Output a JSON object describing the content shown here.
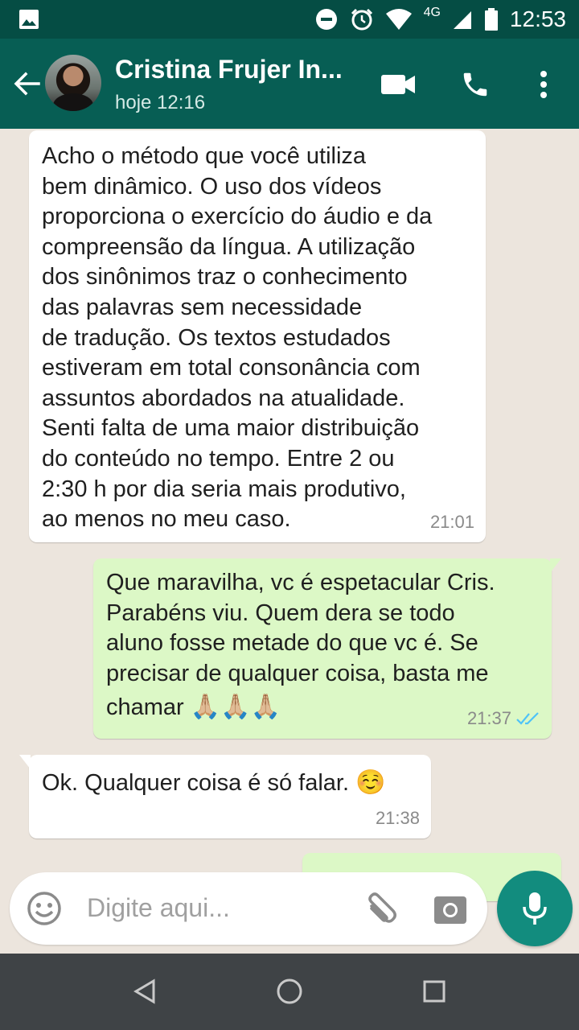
{
  "status_bar": {
    "network": "4G",
    "time": "12:53"
  },
  "header": {
    "contact_name": "Cristina Frujer In...",
    "last_seen": "hoje 12:16",
    "icons": [
      "back-arrow-icon",
      "video-call-icon",
      "phone-icon",
      "more-vert-icon"
    ],
    "color": "#075e54"
  },
  "messages": [
    {
      "direction": "incoming",
      "text": "Acho o método que você utiliza\nbem dinâmico. O uso dos vídeos\nproporciona o exercício do áudio e da\ncompreensão da língua. A utilização\ndos sinônimos traz o conhecimento\ndas palavras sem necessidade\nde tradução. Os textos estudados\nestiveram em total consonância com\nassuntos abordados na atualidade.\nSenti falta de uma maior distribuição\ndo conteúdo no tempo. Entre 2 ou\n2:30 h por dia seria mais produtivo,\nao menos no meu caso.",
      "time": "21:01"
    },
    {
      "direction": "outgoing",
      "text": "Que maravilha, vc é espetacular Cris.\nParabéns viu. Quem dera se todo\naluno fosse metade do que vc é. Se\nprecisar de qualquer coisa, basta me",
      "last_line": "chamar",
      "emoji": "🙏🏼🙏🏼🙏🏼",
      "time": "21:37",
      "status": "read"
    },
    {
      "direction": "incoming",
      "text": "Ok. Qualquer coisa é só falar.",
      "emoji": "☺️",
      "time": "21:38"
    }
  ],
  "composer": {
    "placeholder": "Digite aqui..."
  },
  "colors": {
    "incoming_bubble": "#ffffff",
    "outgoing_bubble": "#dcf8c6",
    "read_ticks": "#4fc3f7",
    "mic_button": "#128c7e"
  }
}
